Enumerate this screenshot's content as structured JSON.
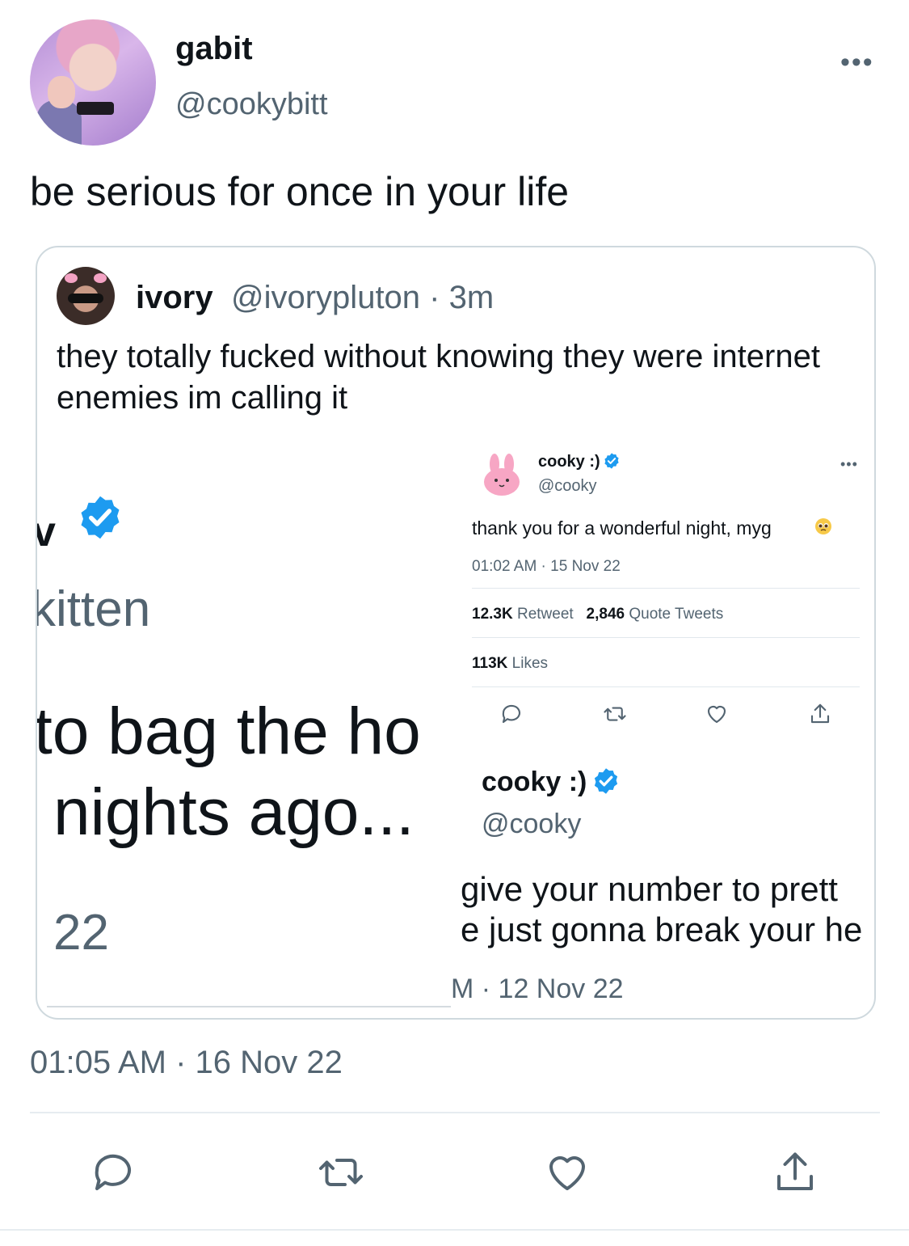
{
  "tweet": {
    "display_name": "gabit",
    "handle": "@cookybitt",
    "more": "•••",
    "text": "be serious for once in your life",
    "timestamp": "01:05 AM · 16 Nov 22",
    "actions": [
      "reply-icon",
      "retweet-icon",
      "like-icon",
      "share-icon"
    ]
  },
  "quote": {
    "display_name": "ivory",
    "handle_time": "@ivorypluton · 3m",
    "text": "they totally fucked without knowing they were internet enemies im calling it",
    "image": {
      "left_fragment": {
        "name_tail": "v",
        "handle_tail": "kitten",
        "line1": "to bag the ho",
        "line2": "nights ago...",
        "date_tail": "22"
      },
      "right_tweet": {
        "display_name": "cooky :)",
        "handle": "@cooky",
        "more": "•••",
        "text": "thank you for a wonderful night, myg",
        "time": "01:02 AM · 15 Nov 22",
        "retweet_count": "12.3K",
        "retweet_label": "Retweet",
        "quote_count": "2,846",
        "quote_label": "Quote Tweets",
        "likes_count": "113K",
        "likes_label": "Likes"
      },
      "second_tweet": {
        "display_name": "cooky :)",
        "handle": "@cooky",
        "line1": "give your number to prett",
        "line2": "e just gonna break your he",
        "time": "M · 12 Nov 22"
      }
    }
  },
  "colors": {
    "verified": "#1d9bf0",
    "muted": "#536471",
    "border": "#cfd9de"
  }
}
